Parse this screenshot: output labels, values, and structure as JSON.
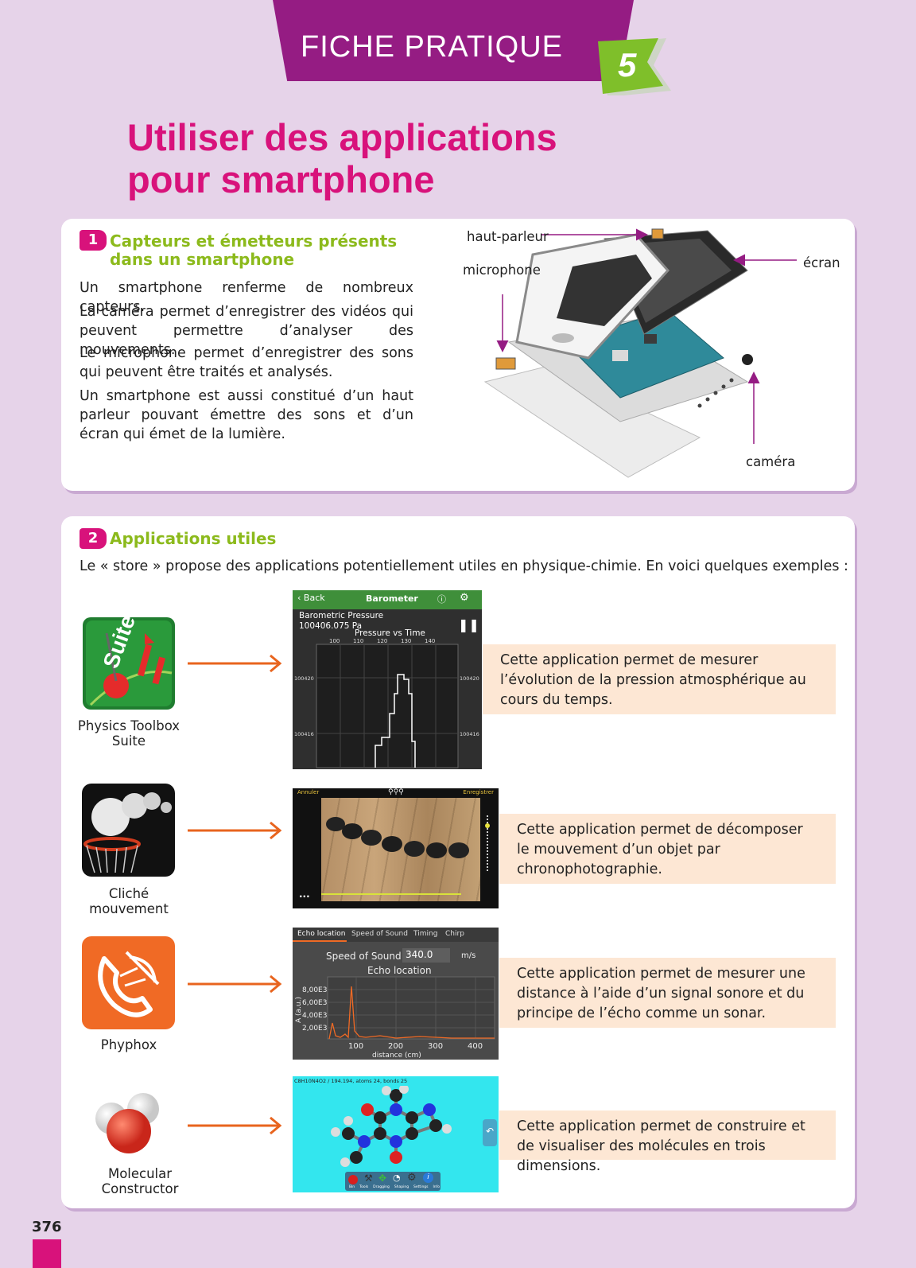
{
  "header": {
    "banner": "FICHE PRATIQUE",
    "number": "5"
  },
  "title": {
    "line1": "Utiliser des applications",
    "line2": "pour smartphone"
  },
  "section1": {
    "num": "1",
    "title_line1": "Capteurs et émetteurs présents",
    "title_line2": "dans un smartphone",
    "paragraphs": [
      "Un smartphone renferme de nombreux capteurs.",
      "La caméra permet d’enregistrer des vidéos qui peuvent permettre d’analyser des mouvements.",
      "Le microphone permet d’enregistrer des sons qui peuvent être traités et analysés.",
      "Un smartphone est aussi constitué d’un haut parleur pouvant émettre des sons et d’un écran qui émet de la lumière."
    ],
    "labels": {
      "speaker": "haut-parleur",
      "microphone": "microphone",
      "screen": "écran",
      "camera": "caméra"
    }
  },
  "section2": {
    "num": "2",
    "title": "Applications utiles",
    "intro": "Le « store » propose des applications potentiellement utiles en physique-chimie. En voici quelques exemples :",
    "apps": [
      {
        "name_line1": "Physics Toolbox",
        "name_line2": "Suite",
        "desc": "Cette application permet de mesurer l’évolution de la pression atmosphérique au cours du temps."
      },
      {
        "name_line1": "Cliché",
        "name_line2": "mouvement",
        "desc": "Cette application permet de décomposer le mouvement d’un objet par chronophotographie."
      },
      {
        "name_line1": "Phyphox",
        "name_line2": "",
        "desc": "Cette application permet de mesurer une distance à l’aide d’un signal sonore et du principe de l’écho comme un sonar."
      },
      {
        "name_line1": "Molecular Constructor",
        "name_line2": "",
        "desc": "Cette application permet de construire et de visualiser des molécules en trois dimensions."
      }
    ],
    "barometer": {
      "back": "Back",
      "title": "Barometer",
      "label": "Barometric Pressure",
      "value": "100406.075 Pa",
      "chart_title": "Pressure vs Time",
      "x_ticks": [
        "100",
        "110",
        "120",
        "130",
        "140"
      ],
      "y_ticks": [
        "100420",
        "100416"
      ]
    },
    "cliche": {
      "left": "Annuler",
      "right": "Enregistrer",
      "more": "..."
    },
    "phyphox": {
      "tabs": [
        "Echo location",
        "Speed of Sound",
        "Timing",
        "Chirp"
      ],
      "speed_label": "Speed of Sound",
      "speed_value": "340.0",
      "speed_unit": "m/s",
      "chart_title": "Echo location",
      "y_ticks": [
        "8,00E3",
        "6,00E3",
        "4,00E3",
        "2,00E3"
      ],
      "y_label": "A (a.u.)",
      "x_ticks": [
        "100",
        "200",
        "300",
        "400"
      ],
      "x_label": "distance (cm)"
    },
    "molecule": {
      "header": "C8H10N4O2 / 194.194, atoms 24, bonds 25",
      "tools": [
        "Bin",
        "Tools",
        "Dragging",
        "Shaping",
        "Settings",
        "Info"
      ]
    }
  },
  "footer": {
    "page": "376"
  }
}
